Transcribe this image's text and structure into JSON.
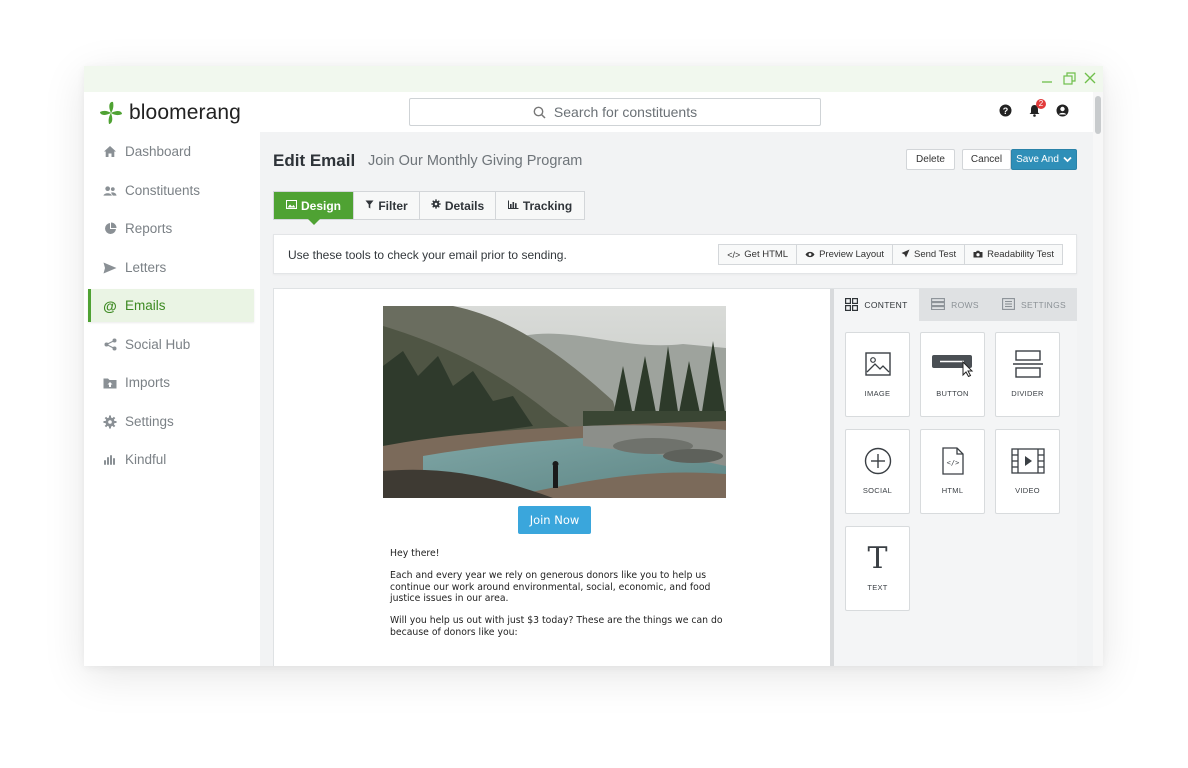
{
  "app": {
    "brand": "bloomerang",
    "brand_color": "#4fa233"
  },
  "search": {
    "placeholder": "Search for constituents"
  },
  "notifications": {
    "count": "2"
  },
  "sidebar": {
    "items": [
      {
        "label": "Dashboard",
        "icon": "home-icon"
      },
      {
        "label": "Constituents",
        "icon": "people-icon"
      },
      {
        "label": "Reports",
        "icon": "pie-chart-icon"
      },
      {
        "label": "Letters",
        "icon": "send-icon"
      },
      {
        "label": "Emails",
        "icon": "at-icon",
        "active": true
      },
      {
        "label": "Social Hub",
        "icon": "share-icon"
      },
      {
        "label": "Imports",
        "icon": "folder-upload-icon"
      },
      {
        "label": "Settings",
        "icon": "gear-icon"
      },
      {
        "label": "Kindful",
        "icon": "kindful-icon"
      }
    ]
  },
  "header": {
    "title": "Edit Email",
    "subtitle": "Join Our Monthly Giving Program",
    "delete_label": "Delete",
    "cancel_label": "Cancel",
    "save_label": "Save And"
  },
  "tabs": [
    {
      "label": "Design",
      "active": true
    },
    {
      "label": "Filter"
    },
    {
      "label": "Details"
    },
    {
      "label": "Tracking"
    }
  ],
  "tools": {
    "message": "Use these tools to check your email prior to sending.",
    "buttons": [
      "Get HTML",
      "Preview Layout",
      "Send Test",
      "Readability Test"
    ]
  },
  "email": {
    "button_label": "Join Now",
    "button_color": "#3aa6dc",
    "greeting": "Hey there!",
    "paragraph1": "Each and every year we rely on generous donors like you to help us continue our work around environmental, social, economic, and food justice issues in our area.",
    "paragraph2": "Will you help us out with just $3 today? These are the things we can do because of donors like you:"
  },
  "panel": {
    "tabs": [
      "CONTENT",
      "ROWS",
      "SETTINGS"
    ],
    "blocks": [
      "IMAGE",
      "BUTTON",
      "DIVIDER",
      "SOCIAL",
      "HTML",
      "VIDEO",
      "TEXT"
    ]
  }
}
